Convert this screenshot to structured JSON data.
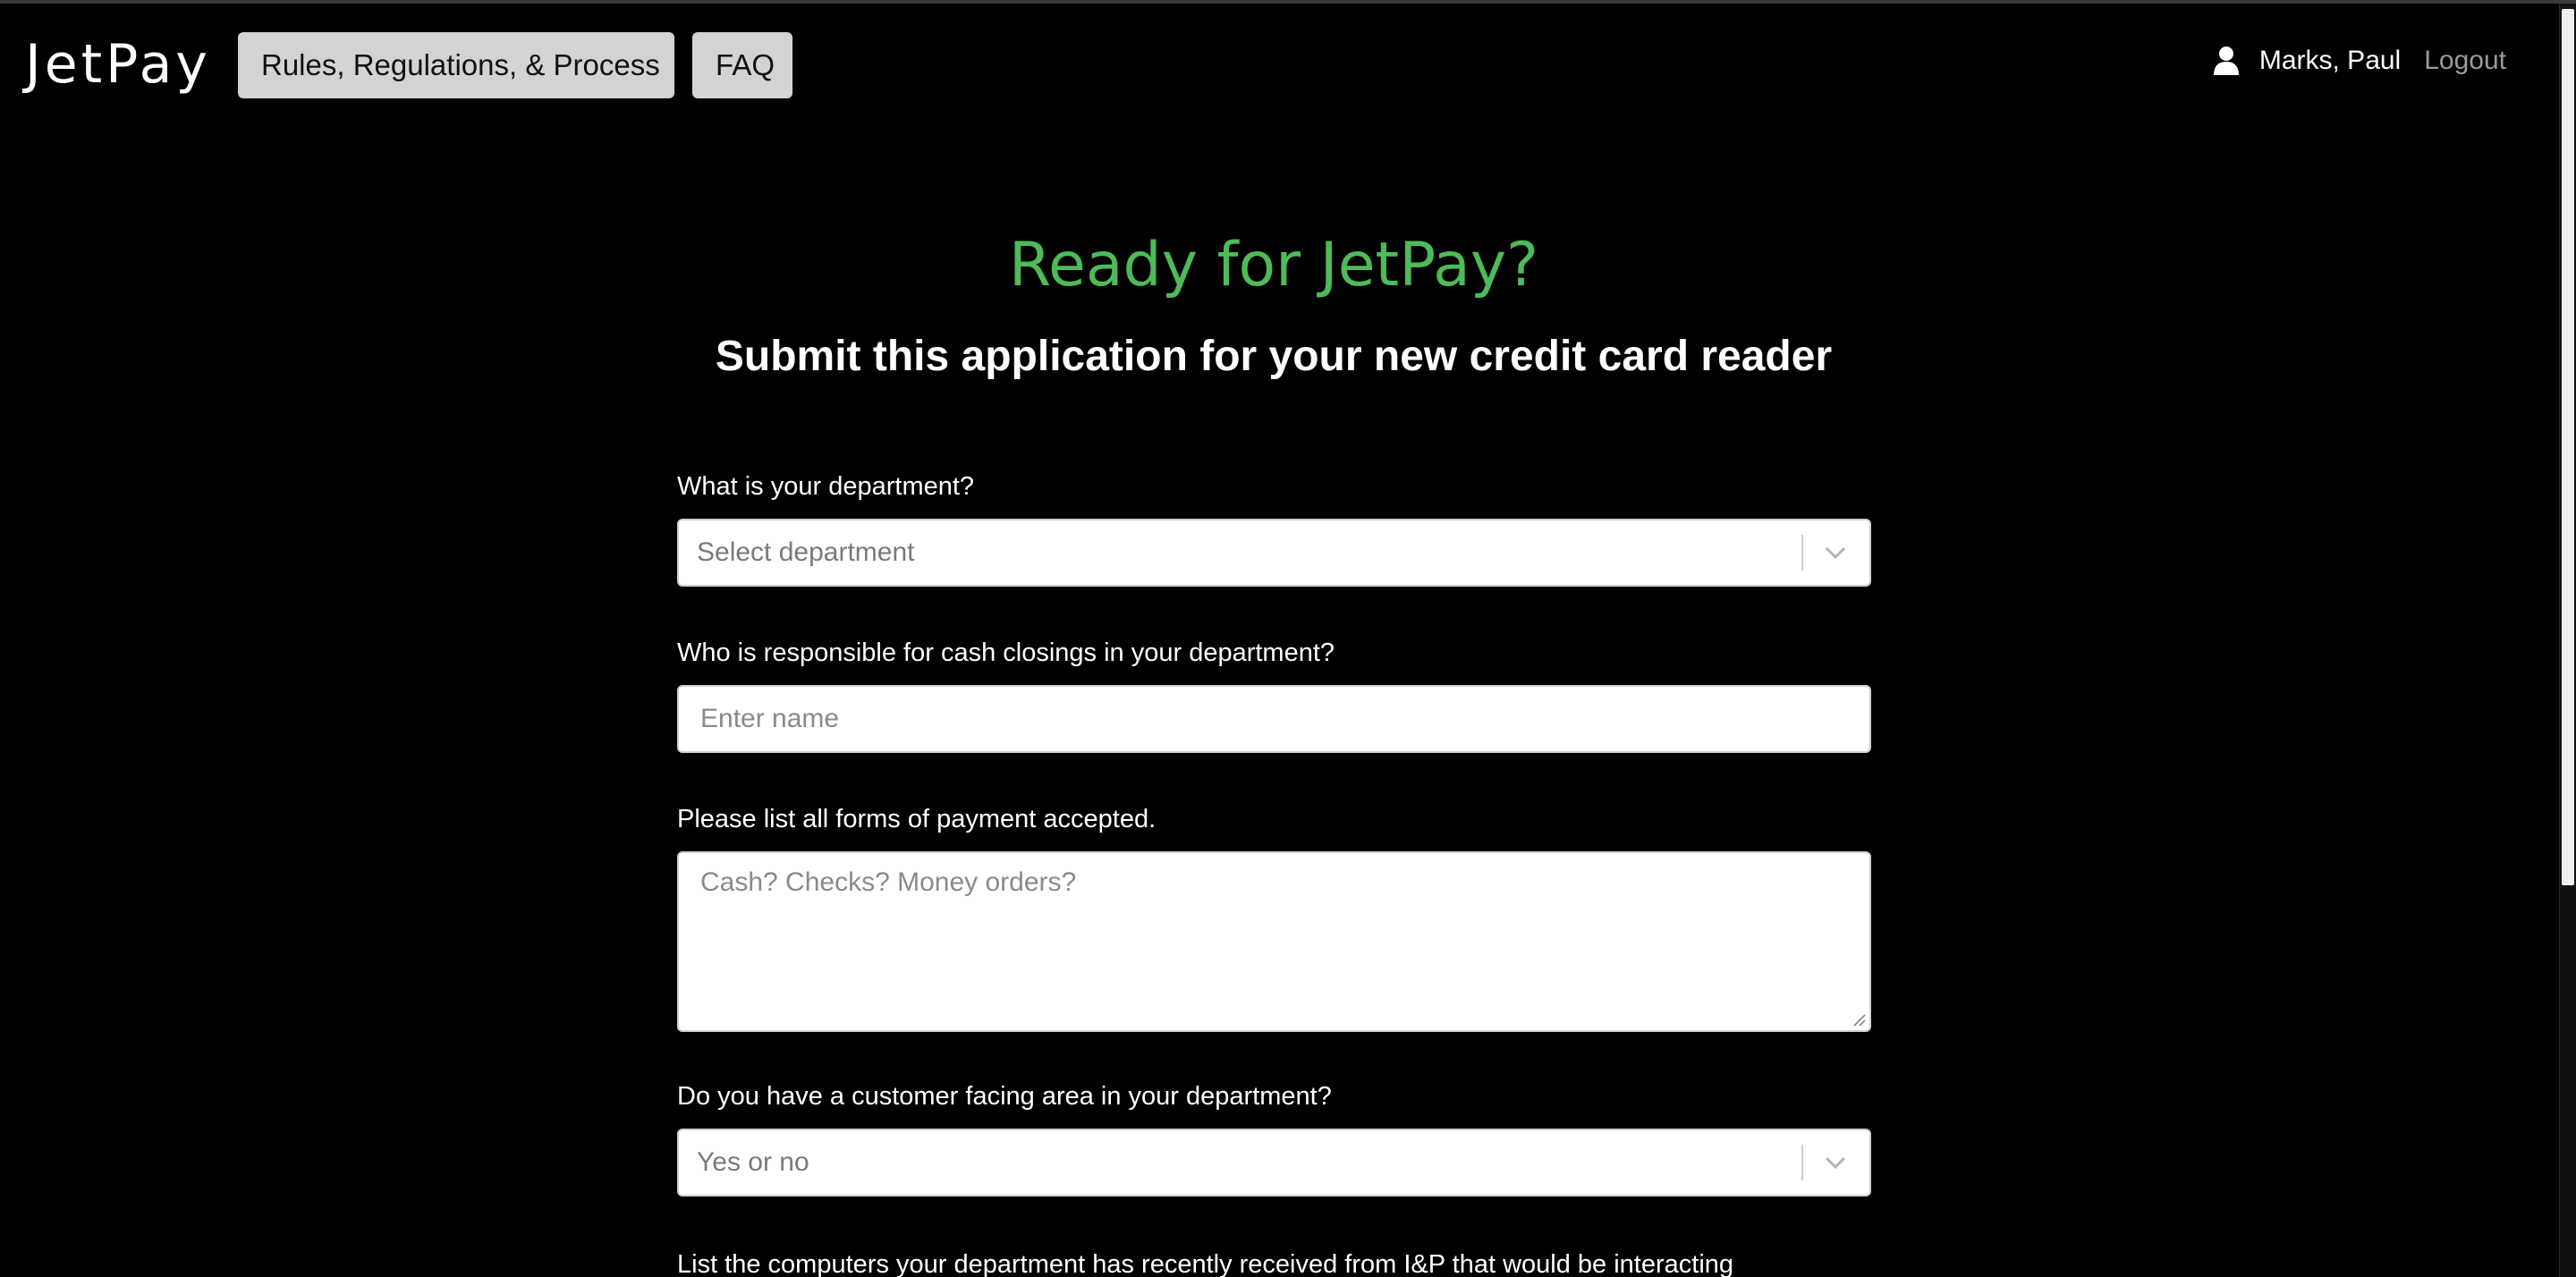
{
  "navbar": {
    "brand": "JetPay",
    "buttons": [
      {
        "label": "Rules, Regulations, & Process"
      },
      {
        "label": "FAQ"
      }
    ],
    "user": {
      "icon": "user-icon",
      "name": "Marks, Paul",
      "logout_label": "Logout"
    }
  },
  "hero": {
    "title": "Ready for JetPay?",
    "subtitle": "Submit this application for your new credit card reader"
  },
  "form": {
    "department": {
      "label": "What is your department?",
      "placeholder": "Select department"
    },
    "cash_closings": {
      "label": "Who is responsible for cash closings in your department?",
      "placeholder": "Enter name"
    },
    "payment_forms": {
      "label": "Please list all forms of payment accepted.",
      "placeholder": "Cash? Checks? Money orders?"
    },
    "customer_facing": {
      "label": "Do you have a customer facing area in your department?",
      "placeholder": "Yes or no"
    },
    "computers": {
      "label": "List the computers your department has recently received from I&P that would be interacting"
    }
  },
  "colors": {
    "background": "#000000",
    "accent_green": "#4dbb58",
    "nav_button_bg": "#d3d3d3",
    "logout_gray": "#9a9a9a"
  }
}
